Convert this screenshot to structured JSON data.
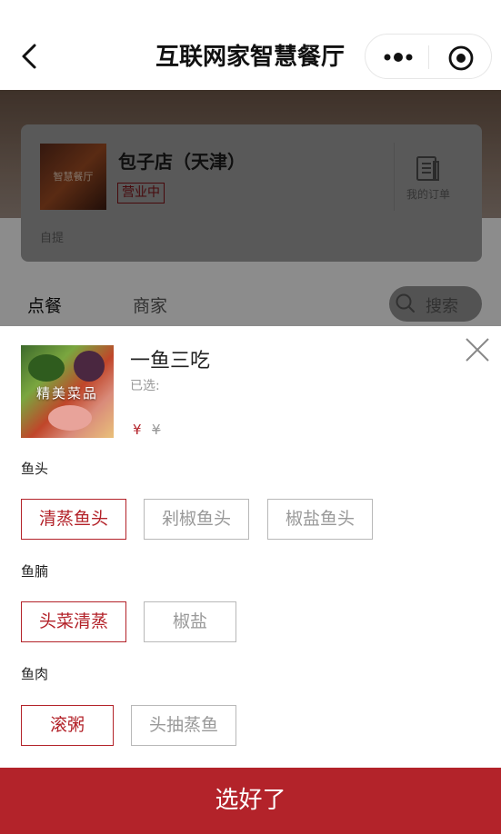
{
  "nav": {
    "title": "互联网家智慧餐厅"
  },
  "store": {
    "image_text": "智慧餐厅",
    "name": "包子店（天津）",
    "status": "营业中",
    "order_label": "我的订单",
    "mode": "自提"
  },
  "tabs": [
    {
      "label": "点餐",
      "active": true
    },
    {
      "label": "商家",
      "active": false
    }
  ],
  "search": {
    "placeholder": "搜索"
  },
  "dish": {
    "image_tag": "精美菜品",
    "name": "一鱼三吃",
    "selected_label": "已选:",
    "price_symbol": "¥",
    "original_price_symbol": "¥"
  },
  "groups": [
    {
      "title": "鱼头",
      "options": [
        {
          "label": "清蒸鱼头",
          "selected": true
        },
        {
          "label": "剁椒鱼头",
          "selected": false
        },
        {
          "label": "椒盐鱼头",
          "selected": false
        }
      ]
    },
    {
      "title": "鱼腩",
      "options": [
        {
          "label": "头菜清蒸",
          "selected": true
        },
        {
          "label": "椒盐",
          "selected": false
        }
      ]
    },
    {
      "title": "鱼肉",
      "options": [
        {
          "label": "滚粥",
          "selected": true
        },
        {
          "label": "头抽蒸鱼",
          "selected": false
        }
      ]
    }
  ],
  "confirm_label": "选好了",
  "colors": {
    "accent": "#b3232a",
    "muted_text": "#999999",
    "border": "#b8b8b8"
  }
}
